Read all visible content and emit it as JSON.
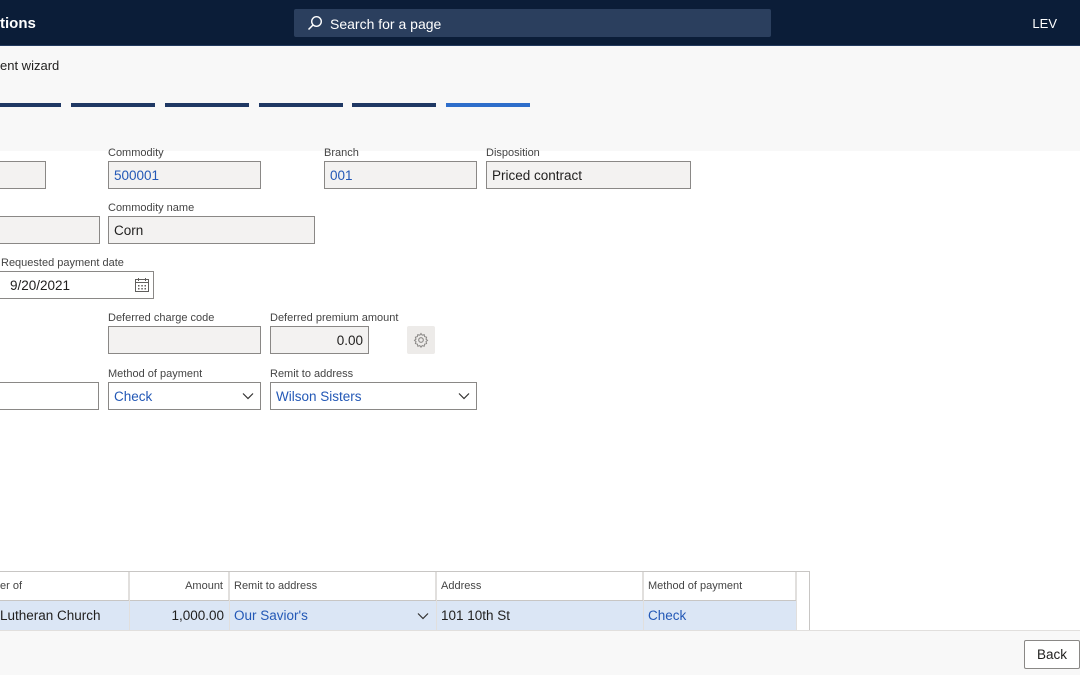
{
  "header": {
    "app_title": "tions",
    "search_placeholder": "Search for a page",
    "company": "LEV"
  },
  "wizard": {
    "title": "ent wizard",
    "steps_total": 6,
    "active_step": 6
  },
  "form": {
    "commodity_label": "Commodity",
    "commodity_value": "500001",
    "branch_label": "Branch",
    "branch_value": "001",
    "disposition_label": "Disposition",
    "disposition_value": "Priced contract",
    "commodity_name_label": "Commodity name",
    "commodity_name_value": "Corn",
    "requested_payment_date_label": "Requested payment date",
    "requested_payment_date_value": "9/20/2021",
    "deferred_charge_code_label": "Deferred charge code",
    "deferred_charge_code_value": "",
    "deferred_premium_amount_label": "Deferred premium amount",
    "deferred_premium_amount_value": "0.00",
    "method_of_payment_label": "Method of payment",
    "method_of_payment_value": "Check",
    "remit_to_address_label": "Remit to address",
    "remit_to_address_value": "Wilson Sisters"
  },
  "grid": {
    "columns": [
      "er of",
      "Amount",
      "Remit to address",
      "Address",
      "Method of payment"
    ],
    "rows": [
      {
        "pay_to": "Lutheran Church",
        "amount": "1,000.00",
        "remit_to_address": "Our Savior's",
        "address": "101 10th St",
        "method_of_payment": "Check"
      }
    ]
  },
  "footer": {
    "back_label": "Back"
  },
  "colors": {
    "nav_bar": "#0b1d38",
    "step_complete": "#1f3864",
    "step_active": "#2e6ecb",
    "link": "#2358b6",
    "selected_row": "#dbe6f5"
  }
}
